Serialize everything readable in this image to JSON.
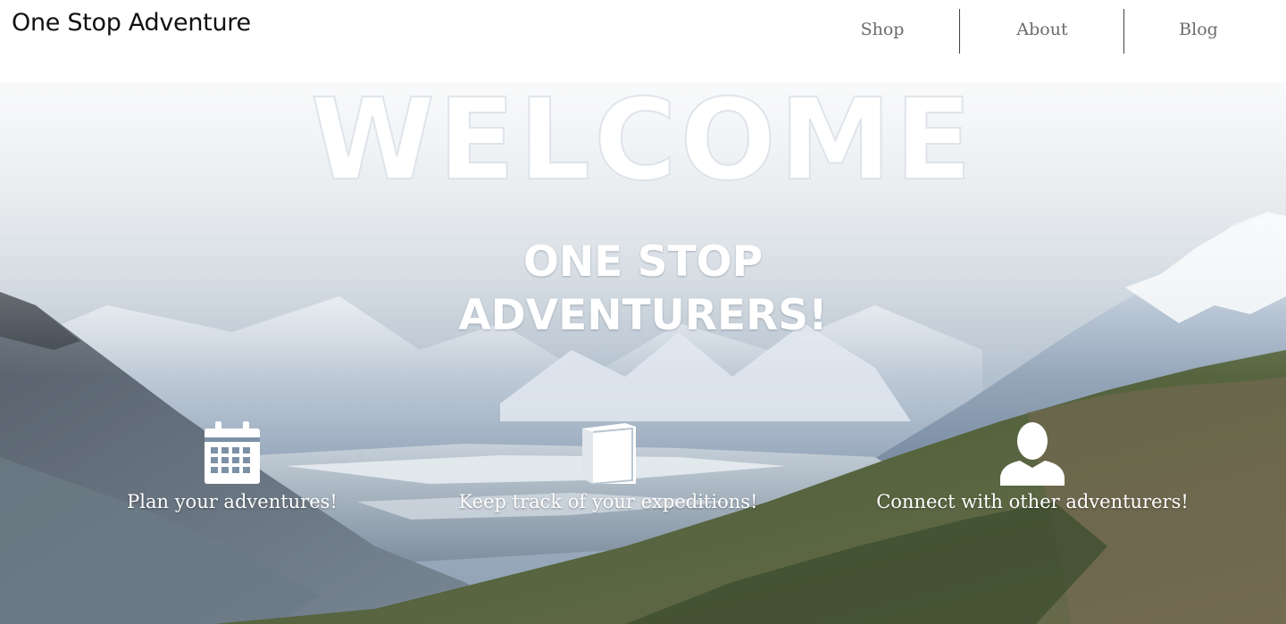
{
  "header": {
    "brand": "One Stop Adventure",
    "nav": {
      "shop": "Shop",
      "about": "About",
      "blog": "Blog"
    }
  },
  "hero": {
    "welcome": "WELCOME",
    "subtitle_line1": "ONE STOP",
    "subtitle_line2": "ADVENTURERS!",
    "features": [
      {
        "icon": "calendar-icon",
        "label": "Plan your adventures!"
      },
      {
        "icon": "book-icon",
        "label": "Keep track of your expeditions!"
      },
      {
        "icon": "user-icon",
        "label": "Connect with other adventurers!"
      }
    ]
  },
  "colors": {
    "header_bg": "#ffffff",
    "brand_text": "#111111",
    "nav_text": "#6b6b6b",
    "hero_text": "#ffffff"
  }
}
